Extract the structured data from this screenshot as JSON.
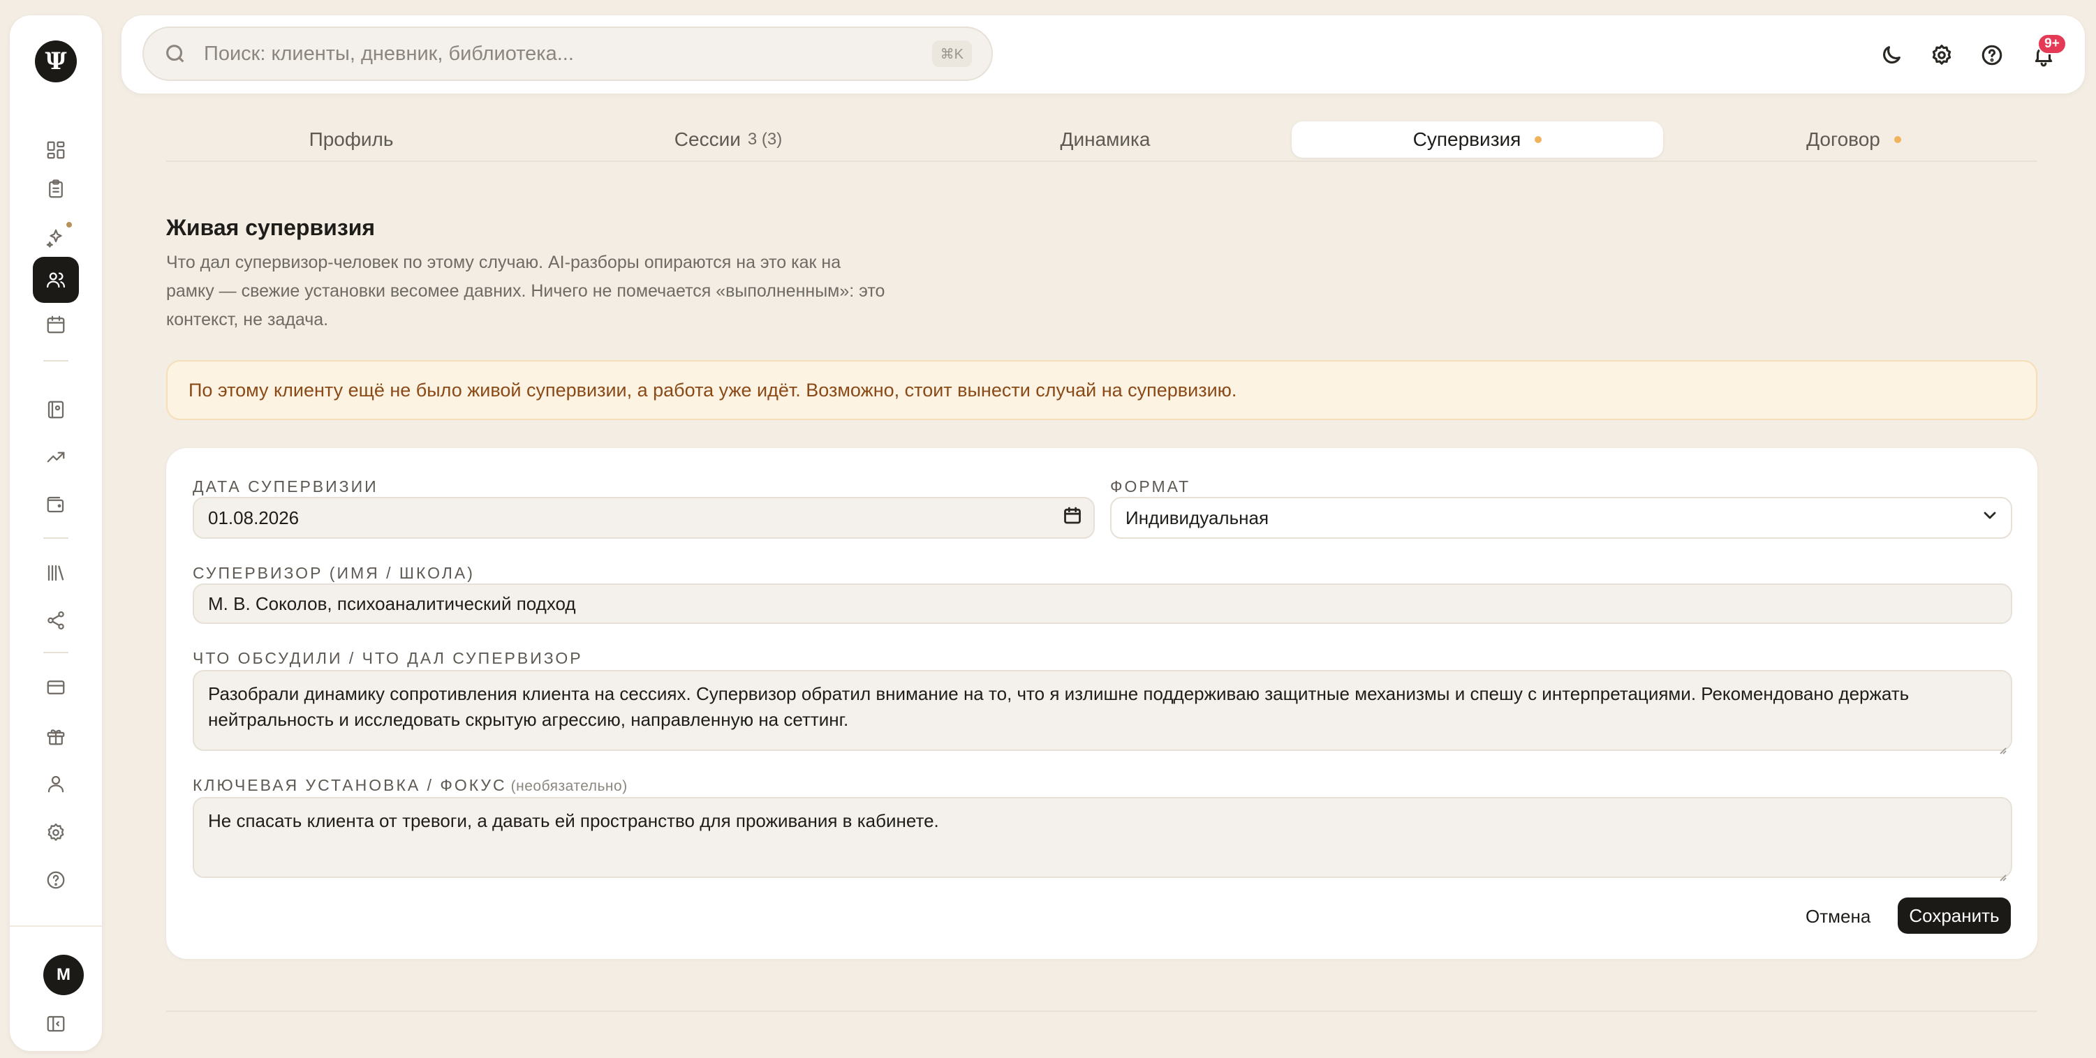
{
  "app": {
    "logo_glyph": "Ψ"
  },
  "search": {
    "placeholder": "Поиск: клиенты, дневник, библиотека...",
    "shortcut": "⌘K"
  },
  "topbar": {
    "icons": [
      "moon-icon",
      "gear-icon",
      "help-icon",
      "bell-icon"
    ],
    "notifications_badge": "9+"
  },
  "sidebar": {
    "items": [
      {
        "icon": "dashboard-icon"
      },
      {
        "icon": "clipboard-icon"
      },
      {
        "icon": "sparkles-icon",
        "dot": true
      },
      {
        "icon": "users-icon",
        "active": true
      },
      {
        "icon": "calendar-icon"
      },
      {
        "icon": "journal-icon"
      },
      {
        "icon": "trending-up-icon"
      },
      {
        "icon": "wallet-icon"
      },
      {
        "icon": "library-icon"
      },
      {
        "icon": "share-icon"
      },
      {
        "icon": "credit-card-icon"
      },
      {
        "icon": "gift-icon"
      },
      {
        "icon": "user-icon"
      },
      {
        "icon": "settings-icon"
      },
      {
        "icon": "help-circle-icon"
      }
    ],
    "avatar_initial": "М",
    "collapse_icon": "sidebar-collapse-icon"
  },
  "tabs": [
    {
      "label": "Профиль"
    },
    {
      "label": "Сессии",
      "count": "3 (3)"
    },
    {
      "label": "Динамика"
    },
    {
      "label": "Супервизия",
      "active": true,
      "dot": true
    },
    {
      "label": "Договор",
      "dot": true
    }
  ],
  "section": {
    "title": "Живая супервизия",
    "description": "Что дал супервизор-человек по этому случаю. AI-разборы опираются на это как на рамку — свежие установки весомее давних. Ничего не помечается «выполненным»: это контекст, не задача.",
    "notice": "По этому клиенту ещё не было живой супервизии, а работа уже идёт. Возможно, стоит вынести случай на супервизию."
  },
  "form": {
    "date_label": "Дата супервизии",
    "date_value": "01.08.2026",
    "format_label": "Формат",
    "format_value": "Индивидуальная",
    "supervisor_label": "Супервизор (имя / школа)",
    "supervisor_value": "М. В. Соколов, психоаналитический подход",
    "discussed_label": "Что обсудили / что дал супервизор",
    "discussed_value": "Разобрали динамику сопротивления клиента на сессиях. Супервизор обратил внимание на то, что я излишне поддерживаю защитные механизмы и спешу с интерпретациями. Рекомендовано держать нейтральность и исследовать скрытую агрессию, направленную на сеттинг.",
    "focus_label": "Ключевая установка / фокус",
    "focus_optional": "(необязательно)",
    "focus_value": "Не спасать клиента от тревоги, а давать ей пространство для проживания в кабинете.",
    "cancel_label": "Отмена",
    "save_label": "Сохранить"
  },
  "colors": {
    "background": "#f3ede4",
    "accent_dark": "#1c1a17",
    "notice_bg": "#fdf3e3",
    "notice_text": "#8a4a18",
    "tab_dot": "#f0b25a",
    "badge": "#e53a56"
  }
}
